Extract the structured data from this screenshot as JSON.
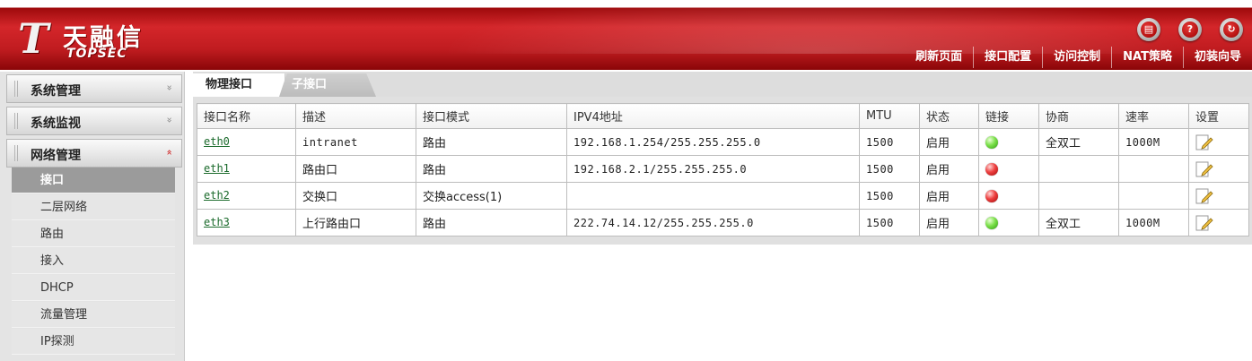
{
  "header": {
    "brand_cn": "天融信",
    "brand_en": "TOPSEC",
    "icons": [
      {
        "name": "save-icon",
        "glyph": "▤"
      },
      {
        "name": "help-icon",
        "glyph": "?"
      },
      {
        "name": "logout-icon",
        "glyph": "↻"
      }
    ],
    "nav": [
      "刷新页面",
      "接口配置",
      "访问控制",
      "NAT策略",
      "初装向导"
    ],
    "colors": {
      "primary_red": "#c01c20"
    }
  },
  "sidebar": {
    "groups": [
      {
        "label": "系统管理",
        "arrow": "»"
      },
      {
        "label": "系统监视",
        "arrow": "»"
      },
      {
        "label": "网络管理",
        "arrow": "«"
      }
    ],
    "items": [
      "接口",
      "二层网络",
      "路由",
      "接入",
      "DHCP",
      "流量管理",
      "IP探测"
    ],
    "active_item": "接口"
  },
  "tabs": {
    "active": "物理接口",
    "inactive": "子接口"
  },
  "table": {
    "headers": [
      "接口名称",
      "描述",
      "接口模式",
      "IPV4地址",
      "MTU",
      "状态",
      "链接",
      "协商",
      "速率",
      "设置"
    ],
    "rows": [
      {
        "name": "eth0",
        "desc": "intranet",
        "mode": "路由",
        "ipv4": "192.168.1.254/255.255.255.0",
        "mtu": "1500",
        "status": "启用",
        "link": "green",
        "negotiation": "全双工",
        "speed": "1000M"
      },
      {
        "name": "eth1",
        "desc": "路由口",
        "mode": "路由",
        "ipv4": "192.168.2.1/255.255.255.0",
        "mtu": "1500",
        "status": "启用",
        "link": "red",
        "negotiation": "",
        "speed": ""
      },
      {
        "name": "eth2",
        "desc": "交换口",
        "mode": "交换access(1)",
        "ipv4": "",
        "mtu": "1500",
        "status": "启用",
        "link": "red",
        "negotiation": "",
        "speed": ""
      },
      {
        "name": "eth3",
        "desc": "上行路由口",
        "mode": "路由",
        "ipv4": "222.74.14.12/255.255.255.0",
        "mtu": "1500",
        "status": "启用",
        "link": "green",
        "negotiation": "全双工",
        "speed": "1000M"
      }
    ]
  }
}
